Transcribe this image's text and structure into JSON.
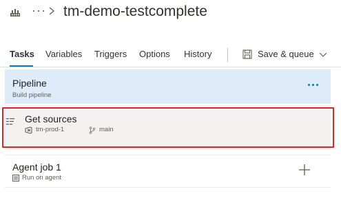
{
  "header": {
    "ellipsis": "···",
    "title": "tm-demo-testcomplete",
    "icons": [
      "pipeline-icon",
      "chevron-right-icon"
    ]
  },
  "tabs": [
    {
      "label": "Tasks",
      "active": true
    },
    {
      "label": "Variables",
      "active": false
    },
    {
      "label": "Triggers",
      "active": false
    },
    {
      "label": "Options",
      "active": false
    },
    {
      "label": "History",
      "active": false
    }
  ],
  "save_queue": {
    "label": "Save & queue",
    "icons": [
      "save-icon",
      "chevron-down-icon"
    ]
  },
  "pipeline": {
    "title": "Pipeline",
    "subtitle": "Build pipeline",
    "more_icon": "more-icon"
  },
  "get_sources": {
    "title": "Get sources",
    "repo": "tm-prod-1",
    "branch": "main",
    "icons": [
      "sources-icon",
      "repo-icon",
      "branch-icon"
    ],
    "selected": true,
    "highlight_color": "#d9262b"
  },
  "agent_job": {
    "title": "Agent job 1",
    "subtitle": "Run on agent",
    "icons": [
      "agent-icon",
      "plus-icon"
    ]
  },
  "colors": {
    "accent": "#0078d4",
    "pipeline_bg": "#deecf9",
    "selected_bg": "#f3f2f1",
    "highlight": "#d9262b"
  }
}
